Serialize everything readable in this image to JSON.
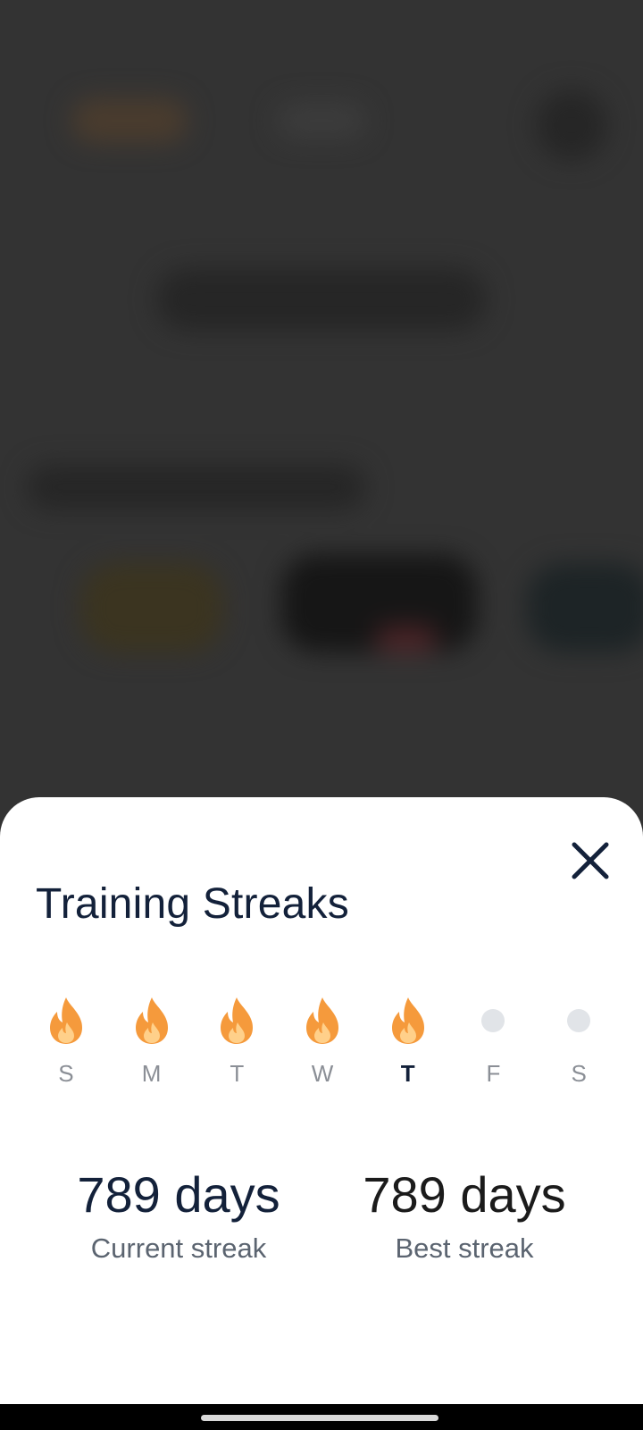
{
  "sheet": {
    "title": "Training Streaks",
    "close_icon": "close-icon"
  },
  "week": [
    {
      "letter": "S",
      "state": "completed",
      "icon": "flame-icon",
      "today": false
    },
    {
      "letter": "M",
      "state": "completed",
      "icon": "flame-icon",
      "today": false
    },
    {
      "letter": "T",
      "state": "completed",
      "icon": "flame-icon",
      "today": false
    },
    {
      "letter": "W",
      "state": "completed",
      "icon": "flame-icon",
      "today": false
    },
    {
      "letter": "T",
      "state": "completed",
      "icon": "flame-icon",
      "today": true
    },
    {
      "letter": "F",
      "state": "empty",
      "icon": "dot-icon",
      "today": false
    },
    {
      "letter": "S",
      "state": "empty",
      "icon": "dot-icon",
      "today": false
    }
  ],
  "stats": {
    "current": {
      "value": "789 days",
      "label": "Current streak"
    },
    "best": {
      "value": "789 days",
      "label": "Best streak"
    }
  },
  "colors": {
    "title": "#13213a",
    "flame_outer": "#f59a3c",
    "flame_inner": "#ffd08a",
    "empty_dot": "#e1e4e8",
    "overlay": "#333333"
  }
}
